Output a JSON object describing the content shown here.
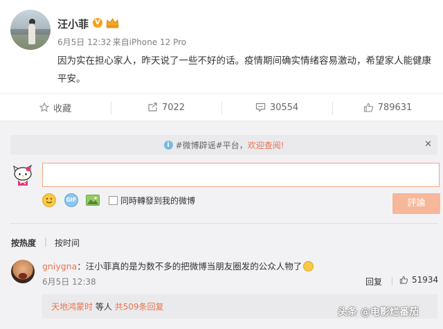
{
  "post": {
    "author": "汪小菲",
    "verified_badge": "V",
    "date": "6月5日 12:32",
    "source": "来自iPhone 12 Pro",
    "content": "因为实在担心家人，昨天说了一些不好的话。疫情期间确实情绪容易激动，希望家人能健康平安。"
  },
  "actions": {
    "favorite": "收藏",
    "repost": "7022",
    "comment": "30554",
    "like": "789631"
  },
  "comment_box": {
    "notice_prefix": "#微博辟谣#平台，",
    "notice_highlight": "欢迎查阅!",
    "close": "✕",
    "gif_label": "GIF",
    "repost_checkbox_label": "同時轉發到我的微博",
    "submit_label": "評論"
  },
  "sort": {
    "hot": "按热度",
    "divider": "|",
    "time": "按时间"
  },
  "comment": {
    "user": "gniygna",
    "colon": "：",
    "text": "汪小菲真的是为数不多的把微博当朋友圈发的公众人物了",
    "date": "6月5日 12:38",
    "reply": "回复",
    "likes": "51934",
    "sub_user": "天地鸿蒙时",
    "sub_middle": " 等人 ",
    "sub_count": "共509条回复"
  },
  "watermark": "头条 @电影烂番茄",
  "colors": {
    "accent": "#eb7350",
    "submit_bg": "#f7b79a",
    "panel_bg": "#f2f2f5"
  }
}
